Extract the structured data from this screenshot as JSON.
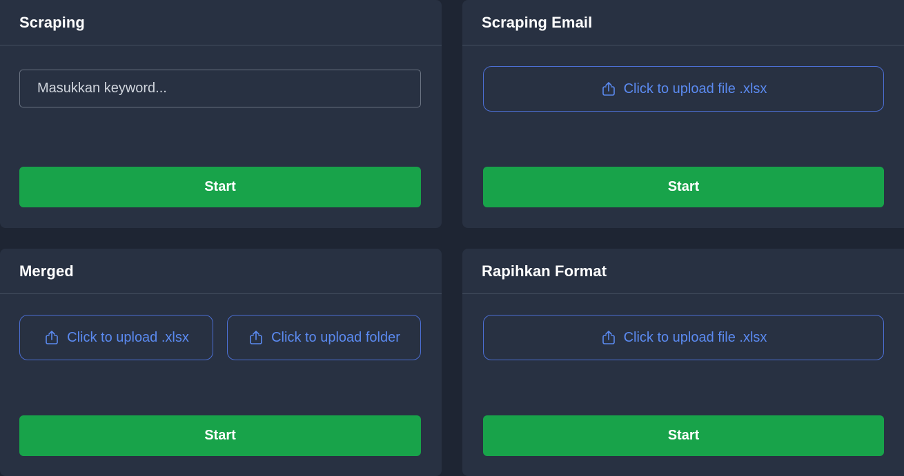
{
  "cards": [
    {
      "title": "Scraping",
      "input_placeholder": "Masukkan keyword...",
      "start_label": "Start"
    },
    {
      "title": "Scraping Email",
      "upload_label": "Click to upload file .xlsx",
      "start_label": "Start"
    },
    {
      "title": "Merged",
      "upload_xlsx_label": "Click to upload .xlsx",
      "upload_folder_label": "Click to upload folder",
      "start_label": "Start"
    },
    {
      "title": "Rapihkan Format",
      "upload_label": "Click to upload file .xlsx",
      "start_label": "Start"
    }
  ],
  "icons": {
    "upload": "upload-icon"
  },
  "colors": {
    "background": "#1e2533",
    "card": "#283142",
    "accent_blue": "#5b8af0",
    "start_green": "#18a34a"
  }
}
